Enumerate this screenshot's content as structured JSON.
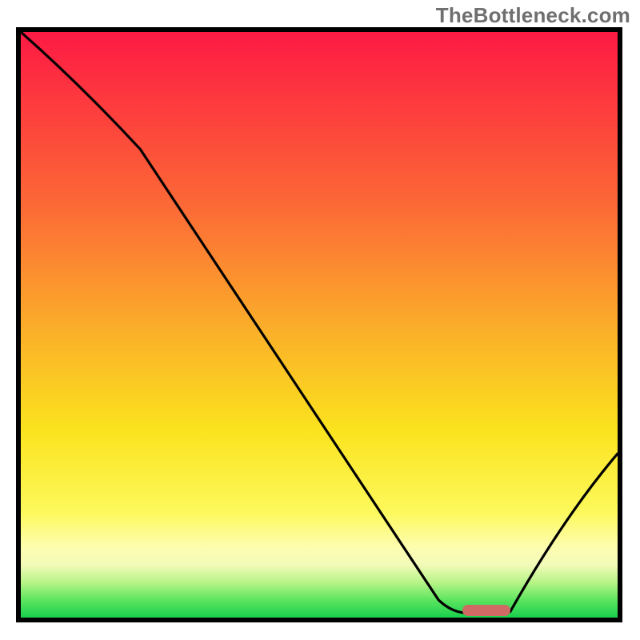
{
  "watermark": "TheBottleneck.com",
  "chart_data": {
    "type": "line",
    "title": "",
    "xlabel": "",
    "ylabel": "",
    "xlim": [
      0,
      100
    ],
    "ylim": [
      0,
      100
    ],
    "grid": false,
    "legend": false,
    "series": [
      {
        "name": "bottleneck-curve",
        "x": [
          0,
          20,
          70,
          76,
          82,
          100
        ],
        "values": [
          100,
          80,
          3,
          1,
          1,
          28
        ]
      }
    ],
    "marker": {
      "x_start": 74,
      "x_end": 82,
      "y": 1.2
    },
    "gradient_stops": [
      {
        "pct": 0,
        "color": "#fd1a44"
      },
      {
        "pct": 50,
        "color": "#fbac2a"
      },
      {
        "pct": 82,
        "color": "#fdf95c"
      },
      {
        "pct": 100,
        "color": "#18cf4e"
      }
    ]
  }
}
